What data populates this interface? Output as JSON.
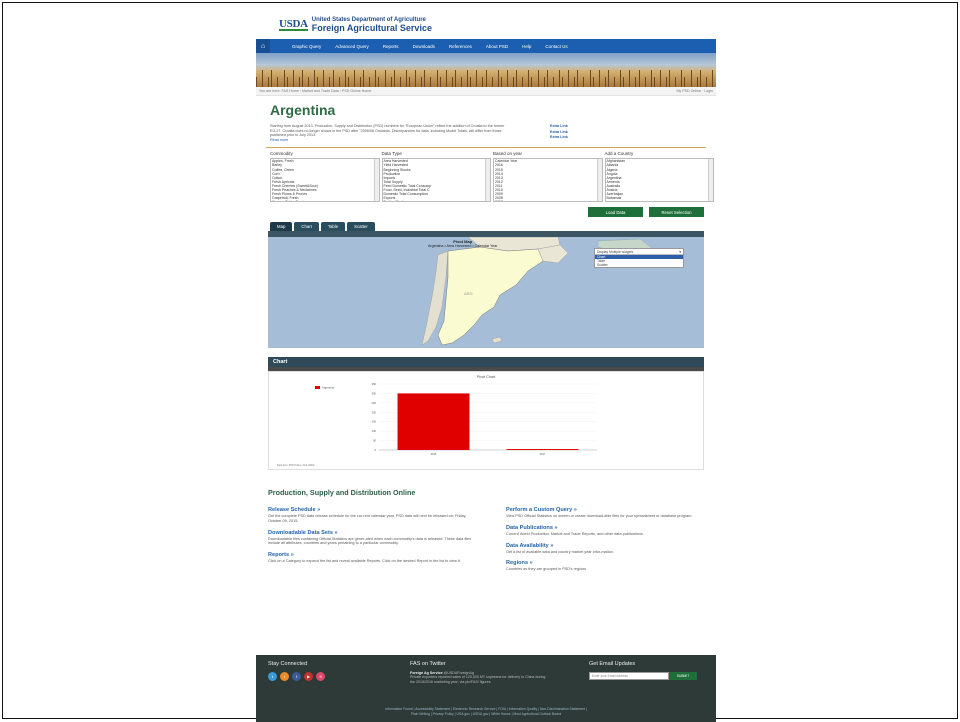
{
  "agency": {
    "logo": "USDA",
    "line1": "United States Department of Agriculture",
    "line2": "Foreign Agricultural Service"
  },
  "nav": {
    "home_icon": "home-icon",
    "items": [
      "Graphic Query",
      "Advanced Query",
      "Reports",
      "Downloads",
      "References",
      "About PSD",
      "Help",
      "Contact Us"
    ]
  },
  "breadcrumb": {
    "left": "You are here: FAS Home › Market and Trade Data › PSD Online Home",
    "right": "My PSD Online · Login"
  },
  "page_title": "Argentina",
  "intro": {
    "text": "Starting from August 2013, Production, Supply and Distribution (PSD) numbers for \"European Union\" reflect the addition of Croatia to the former EU-27. Croatia does no longer shows in the PSD after \"2006/08 Onwards. Discrepancies for data, including Model Totals, will differ from those published prior to July 2013.",
    "read_more": "Read more",
    "links": [
      "Extra Link",
      "Extra Link",
      "Extra Link"
    ]
  },
  "filters": [
    {
      "label": "Commodity",
      "options": [
        "Apples, Fresh",
        "Barley",
        "Coffee, Green",
        "Corn",
        "Cotton",
        "Fresh Apricots",
        "Fresh Cherries (Sweet&Sour)",
        "Fresh Peaches & Nectarines",
        "Fresh Plums & Prunes",
        "Grapefruit, Fresh",
        "Grapes, Table, Fresh"
      ]
    },
    {
      "label": "Data Type",
      "options": [
        "Area Harvested",
        "Yield Harvested",
        "Beginning Stocks",
        "Production",
        "Imports",
        "Total Supply",
        "Feed Domestic Total Consump",
        "Food, Seed, Industrial Total C",
        "Domestic Total Consumption",
        "Exports",
        "Ending Stocks"
      ]
    },
    {
      "label": "Based on year",
      "options": [
        "Calendar Year",
        "2016",
        "2015",
        "2014",
        "2013",
        "2012",
        "2011",
        "2010",
        "2009",
        "2008",
        "2007"
      ]
    },
    {
      "label": "Add a Country",
      "options": [
        "Afghanistan",
        "Albania",
        "Algeria",
        "Angola",
        "Argentina",
        "Armenia",
        "Australia",
        "Austria",
        "Azerbaijan",
        "Bahamas"
      ]
    }
  ],
  "buttons": {
    "load": "Load Data",
    "reset": "Reset Selection"
  },
  "tabs": [
    "Map",
    "Chart",
    "Table",
    "Scatter"
  ],
  "map": {
    "title": "Pivot Map",
    "subtitle": "Argentina • Area Harvested • Calendar Year",
    "dropdown_current": "Display Multiple widgets",
    "dropdown_options": [
      "Chart",
      "Table",
      "Scatter"
    ],
    "country_label": "ARG"
  },
  "chart_section": {
    "title": "Chart"
  },
  "chart_data": {
    "type": "bar",
    "title": "Pivot Chart",
    "legend": [
      "Argentina"
    ],
    "categories": [
      "2016",
      "2017"
    ],
    "values": [
      300,
      5
    ],
    "ylim": [
      0,
      350
    ],
    "yticks": [
      "350",
      "300",
      "250",
      "200",
      "150",
      "100",
      "50",
      "0"
    ],
    "footer": "Data from: PSD Online, FAS USDA"
  },
  "psd": {
    "title": "Production, Supply and Distribution Online",
    "left": [
      {
        "title": "Release Schedule »",
        "desc": "Get the complete PSD data release schedule for the cur-rent calendar year. PSD data will next be released on: Friday, October 09, 2015."
      },
      {
        "title": "Downloadable Data Sets »",
        "desc": "Downloadable files containing Official Statistics are gener-ated when each commodity's data is released. These data files include all attributes, countries and years pertaining to a particular commodity."
      },
      {
        "title": "Reports »",
        "desc": "Click on a Category to expand the list and reveal available Reports. Click on the desired Report in the list to view it."
      }
    ],
    "right": [
      {
        "title": "Perform a Custom Query »",
        "desc": "View PSD Official Statistics on screen or create download-able files for your spreadsheet or database program."
      },
      {
        "title": "Data Publications »",
        "desc": "Current World Production, Market and Trade Reports, and other data publications."
      },
      {
        "title": "Data Availability »",
        "desc": "Get a list of available data and country market year infor-mation."
      },
      {
        "title": "Regions »",
        "desc": "Countries as they are grouped in PSD's regions"
      }
    ]
  },
  "footer": {
    "stay_connected": "Stay Connected",
    "social": [
      {
        "name": "twitter-icon",
        "glyph": "t",
        "color": "#3a9ad9"
      },
      {
        "name": "rss-icon",
        "glyph": "r",
        "color": "#e88b2a"
      },
      {
        "name": "facebook-icon",
        "glyph": "f",
        "color": "#3b5b98"
      },
      {
        "name": "youtube-icon",
        "glyph": "▶",
        "color": "#c4302b"
      },
      {
        "name": "flickr-icon",
        "glyph": "fl",
        "color": "#d94a6a"
      }
    ],
    "twitter_title": "FAS on Twitter",
    "tweet_author": "Foreign Ag Service",
    "tweet_handle": "@USDAForeignAg",
    "tweet_text": "Private exporters reported sales of 120,000 MT soybeans for delivery to China during the 2015/2016 marketing year; via pic/FAS/ figures",
    "email_title": "Get Email Updates",
    "email_placeholder": "Enter your Email Address",
    "email_submit": "SUBMIT",
    "links_line1": "Information Found | Accessibility Statement | Electronic Research Service | FOIA | Information Quality | Non-Discrimination Statement |",
    "links_line2": "Plain Writing | Privacy Policy | USA.gov | USDA.gov | White House | Most Agricultural Outlook Board"
  }
}
